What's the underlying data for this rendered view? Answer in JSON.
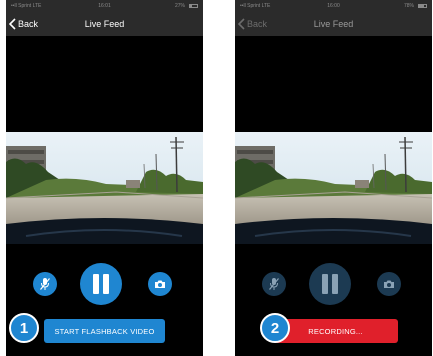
{
  "colors": {
    "accent_blue": "#1f86d1",
    "dim_blue": "#1c3a52",
    "recording_red": "#e0202b",
    "nav_bg": "#2b2b2b"
  },
  "screens": [
    {
      "status": {
        "carrier": "••ll Sprint LTE",
        "time": "16:01",
        "battery": "27%",
        "battery_level": 0.27
      },
      "nav": {
        "back_label": "Back",
        "title": "Live Feed"
      },
      "controls": {
        "mic": "mic-off-icon",
        "pause": "pause-icon",
        "camera": "camera-icon"
      },
      "step_number": "1",
      "action_label": "START FLASHBACK VIDEO"
    },
    {
      "status": {
        "carrier": "••ll Sprint LTE",
        "time": "16:00",
        "battery": "78%",
        "battery_level": 0.78
      },
      "nav": {
        "back_label": "Back",
        "title": "Live Feed"
      },
      "controls": {
        "mic": "mic-off-icon",
        "pause": "pause-icon",
        "camera": "camera-icon"
      },
      "step_number": "2",
      "action_label": "RECORDING..."
    }
  ]
}
